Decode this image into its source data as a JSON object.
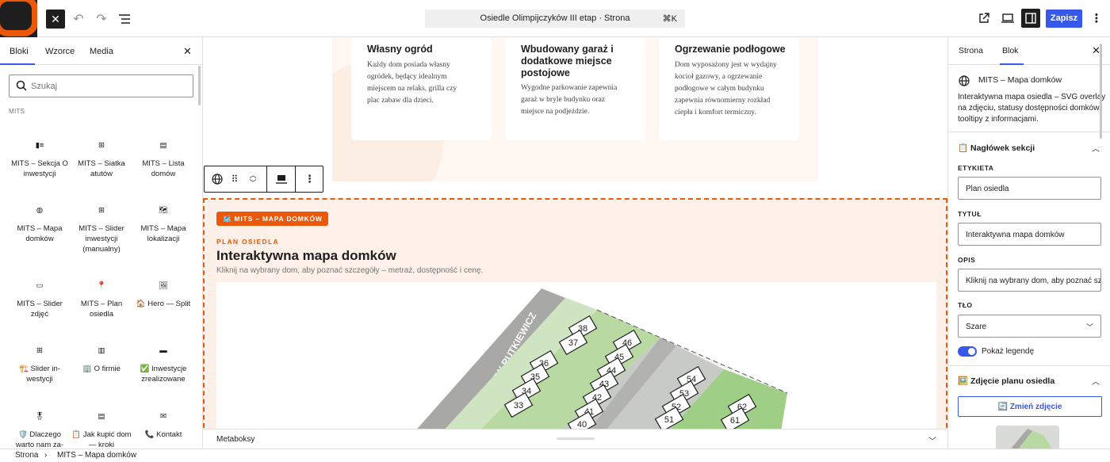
{
  "topbar": {
    "document_title": "Osiedle Olimpijczyków III etap · Strona",
    "shortcut": "⌘K",
    "save_label": "Zapisz",
    "icons": [
      "close-icon",
      "undo-icon",
      "redo-icon",
      "list-view-icon",
      "view-external-icon",
      "desktop-preview-icon",
      "settings-sidebar-icon",
      "more-icon"
    ]
  },
  "inserter": {
    "tabs": [
      "Bloki",
      "Wzorce",
      "Media"
    ],
    "active_tab": "Bloki",
    "search_placeholder": "Szukaj",
    "category": "MITS",
    "blocks": [
      {
        "label": "MITS – Sekcja O inwestycji",
        "icon": "▮≡"
      },
      {
        "label": "MITS – Siatka atutów",
        "icon": "⊞"
      },
      {
        "label": "MITS – Lista domów",
        "icon": "▤"
      },
      {
        "label": "MITS – Mapa domków",
        "icon": "◍"
      },
      {
        "label": "MITS – Slider inwestycji (manualny)",
        "icon": "⊞"
      },
      {
        "label": "MITS – Mapa lokalizacji",
        "icon": "🗺"
      },
      {
        "label": "MITS – Slider zdjęć",
        "icon": "▭"
      },
      {
        "label": "MITS – Plan osiedla",
        "icon": "📍"
      },
      {
        "label": "🏠 Hero — Split",
        "icon": "🖼"
      },
      {
        "label": "🏗️ Slider in-westycji",
        "icon": "⊞"
      },
      {
        "label": "🏢 O firmie",
        "icon": "▥"
      },
      {
        "label": "✅ Inwestycje zrealizowane",
        "icon": "▬"
      },
      {
        "label": "🛡️ Dlaczego warto nam za-",
        "icon": "🎖"
      },
      {
        "label": "📋 Jak kupić dom — kroki",
        "icon": "▤"
      },
      {
        "label": "📞 Kontakt",
        "icon": "✉"
      }
    ]
  },
  "canvas": {
    "features": [
      {
        "title": "Własny ogród",
        "text": "Każdy dom posiada własny ogródek, będący idealnym miejscem na relaks, grilla czy plac zabaw dla dzieci."
      },
      {
        "title": "Wbudowany garaż i dodatkowe miejsce postojowe",
        "text": "Wygodne parkowanie zapewnia garaż w bryle budynku oraz miejsce na podjeździe."
      },
      {
        "title": "Ogrzewanie podłogowe",
        "text": "Dom wyposażony jest w wydajny kocioł gazowy, a ogrzewanie podłogowe w całym budynku zapewnia równomierny rozkład ciepła i komfort termiczny."
      }
    ],
    "block_badge": "🗺️ MITS – MAPA DOMKÓW",
    "section_label": "PLAN OSIEDLA",
    "section_title": "Interaktywna mapa domków",
    "section_desc": "Kliknij na wybrany dom, aby poznać szczegóły – metraż, dostępność i cenę.",
    "map_street": "ALEJA GWIAZDY RUTKIEWICZ",
    "map_lots": [
      "38",
      "37",
      "46",
      "45",
      "44",
      "43",
      "42",
      "41",
      "40",
      "36",
      "35",
      "34",
      "33",
      "54",
      "53",
      "52",
      "51",
      "62",
      "61"
    ]
  },
  "metabox_label": "Metaboksy",
  "breadcrumb": [
    "Strona",
    "MITS – Mapa domków"
  ],
  "sidebar": {
    "tabs": [
      "Strona",
      "Blok"
    ],
    "active_tab": "Blok",
    "block_name": "MITS – Mapa domków",
    "block_desc": "Interaktywna mapa osiedla – SVG overlay na zdjęciu, statusy dostępności domków, tooltipy z informacjami.",
    "panel_header_title": "📋 Nagłówek sekcji",
    "fields": {
      "etykieta_label": "ETYKIETA",
      "etykieta_value": "Plan osiedla",
      "tytul_label": "TYTUŁ",
      "tytul_value": "Interaktywna mapa domków",
      "opis_label": "OPIS",
      "opis_value": "Kliknij na wybrany dom, aby poznać szczegóły",
      "tlo_label": "TŁO",
      "tlo_value": "Szare"
    },
    "legend_toggle_label": "Pokaż legendę",
    "legend_toggle_on": true,
    "panel_image_title": "🖼️ Zdjęcie planu osiedla",
    "change_image_label": "🔄 Zmień zdjęcie"
  },
  "colors": {
    "accent": "#3858e9",
    "brand_orange": "#ea580c",
    "dark": "#1e1e1e"
  }
}
